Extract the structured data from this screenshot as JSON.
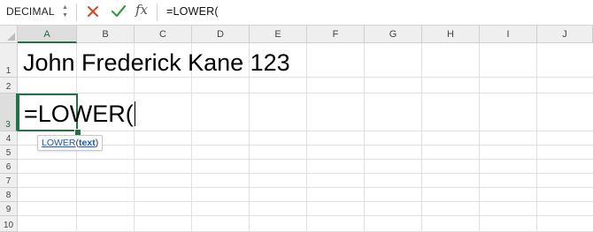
{
  "formula_bar": {
    "name_box": "DECIMAL",
    "cancel_icon": "cross-icon",
    "enter_icon": "check-icon",
    "fx_label": "fx",
    "formula": "=LOWER("
  },
  "columns": [
    "A",
    "B",
    "C",
    "D",
    "E",
    "F",
    "G",
    "H",
    "I",
    "J"
  ],
  "rows": [
    "1",
    "2",
    "3",
    "4",
    "5",
    "6",
    "7",
    "8",
    "9",
    "10"
  ],
  "cells": {
    "A1": "John Frederick Kane 123",
    "A3": "=LOWER("
  },
  "tooltip": {
    "function": "LOWER",
    "open": "(",
    "argument": "text",
    "close": ")"
  },
  "colors": {
    "accent": "#217346",
    "cancel": "#d24726",
    "enter": "#3a9a4a",
    "tooltip_link": "#1a5fb4"
  }
}
